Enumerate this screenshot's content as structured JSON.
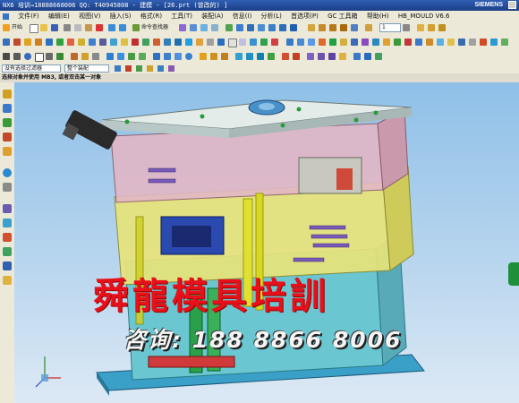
{
  "window": {
    "title": "NX6 培训→18888668006 QQ: T40945808 - 建模 - [26.prt  (曾改的) ]",
    "brand": "SIEMENS"
  },
  "menu": [
    "文件(F)",
    "编辑(E)",
    "视图(V)",
    "插入(S)",
    "格式(R)",
    "工具(T)",
    "装配(A)",
    "信息(I)",
    "分析(L)",
    "首选项(P)",
    "GC 工具箱",
    "帮助(H)",
    "HB_MOULD V6.6"
  ],
  "toolbar": {
    "start_label": "开始",
    "command_finder_label": "命令查找器",
    "layer_value": "1"
  },
  "selection": {
    "filter_value": "没有选择过滤器",
    "scope_value": "整个装配"
  },
  "status": {
    "message": "选择对象并使用 MB3, 或者双击某一对象"
  },
  "watermark": {
    "line1": "舜龍模具培訓",
    "line2": "咨询: 188 8866 8006"
  },
  "colors": {
    "title_bg": "#1c3f86",
    "toolbar_bg": "#ece9d8",
    "viewport_top": "#8fc0e8",
    "watermark_red": "#e8101a"
  }
}
